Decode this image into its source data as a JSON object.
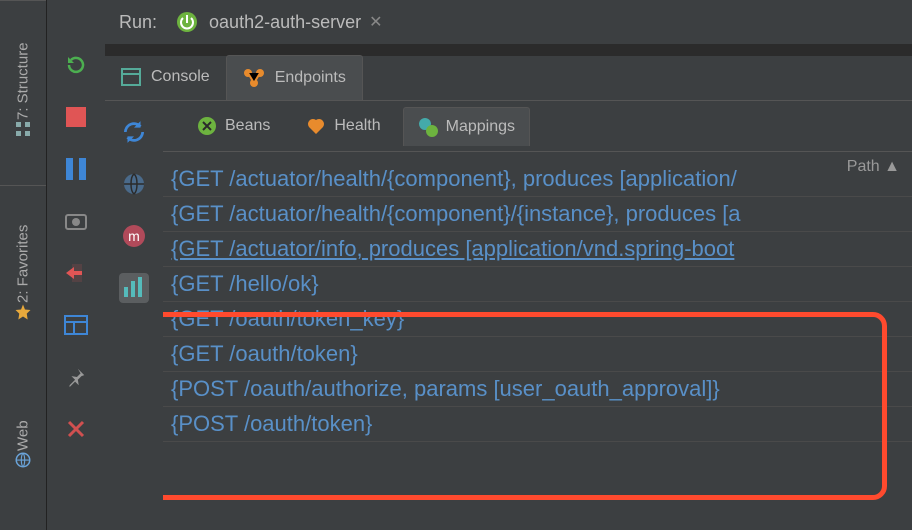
{
  "rail": {
    "structure": "7: Structure",
    "favorites": "2: Favorites",
    "web": "Web"
  },
  "header": {
    "run_label": "Run:",
    "config_name": "oauth2-auth-server"
  },
  "tabs1": {
    "console": "Console",
    "endpoints": "Endpoints"
  },
  "tabs2": {
    "beans": "Beans",
    "health": "Health",
    "mappings": "Mappings"
  },
  "table": {
    "col_path": "Path",
    "rows": [
      "{GET /actuator/health/{component}, produces [application/",
      "{GET /actuator/health/{component}/{instance}, produces [a",
      "{GET /actuator/info, produces [application/vnd.spring-boot",
      "{GET /hello/ok}",
      "{GET /oauth/token_key}",
      "{GET /oauth/token}",
      "{POST /oauth/authorize, params [user_oauth_approval]}",
      "{POST /oauth/token}"
    ]
  }
}
